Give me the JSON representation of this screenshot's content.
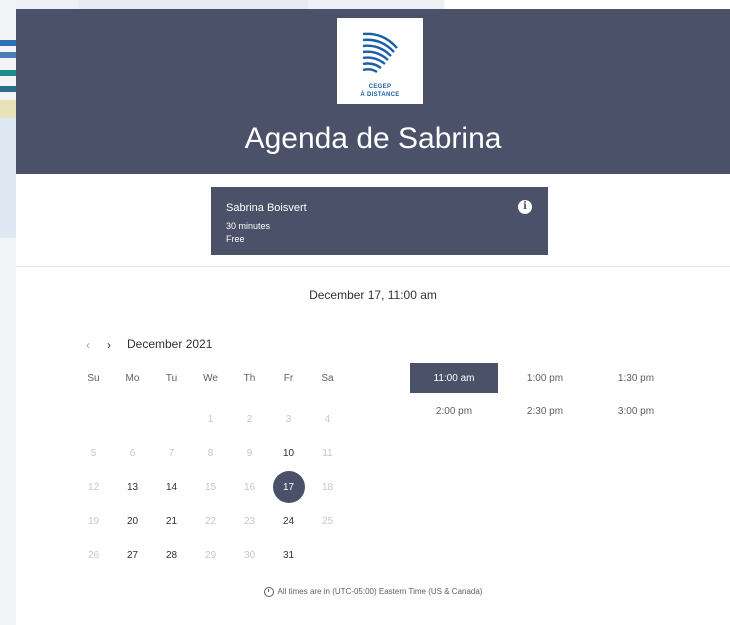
{
  "header": {
    "logo_line1": "CEGEP",
    "logo_line2": "À DISTANCE",
    "title": "Agenda de Sabrina"
  },
  "card": {
    "name": "Sabrina Boisvert",
    "duration": "30 minutes",
    "price": "Free",
    "info_symbol": "i"
  },
  "selected_date": "December 17, 11:00 am",
  "calendar": {
    "prev": "‹",
    "next": "›",
    "month": "December 2021",
    "weekdays": [
      "Su",
      "Mo",
      "Tu",
      "We",
      "Th",
      "Fr",
      "Sa"
    ],
    "rows": [
      [
        "",
        "",
        "",
        "1",
        "2",
        "3",
        "4"
      ],
      [
        "5",
        "6",
        "7",
        "8",
        "9",
        "10",
        "11"
      ],
      [
        "12",
        "13",
        "14",
        "15",
        "16",
        "17",
        "18"
      ],
      [
        "19",
        "20",
        "21",
        "22",
        "23",
        "24",
        "25"
      ],
      [
        "26",
        "27",
        "28",
        "29",
        "30",
        "31",
        ""
      ]
    ],
    "available_days": [
      "10",
      "13",
      "14",
      "17",
      "20",
      "21",
      "24",
      "27",
      "28",
      "31"
    ],
    "selected_day": "17"
  },
  "time_slots": [
    "11:00 am",
    "1:00 pm",
    "1:30 pm",
    "2:00 pm",
    "2:30 pm",
    "3:00 pm"
  ],
  "selected_slot": "11:00 am",
  "timezone_note": "All times are in (UTC-05:00) Eastern Time (US & Canada)",
  "colors": {
    "header_bg": "#4a5168",
    "accent": "#4a5168"
  }
}
